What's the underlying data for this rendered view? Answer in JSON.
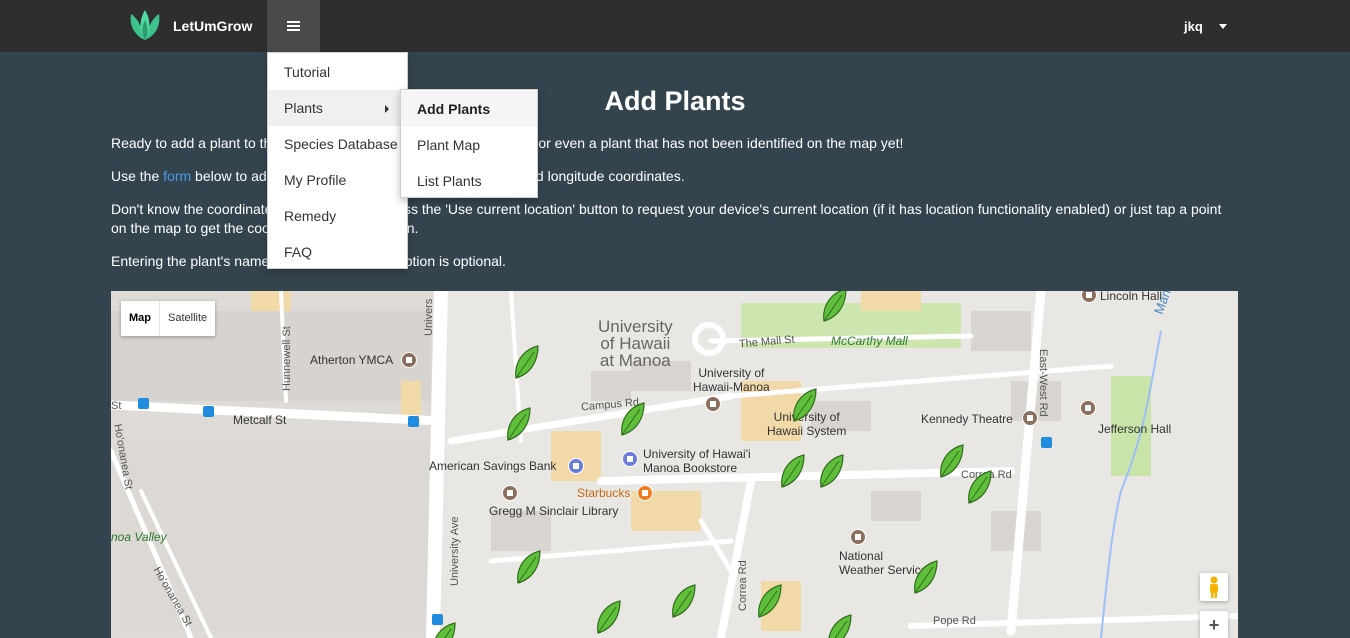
{
  "nav": {
    "brand": "LetUmGrow",
    "user": "jkq",
    "brand_color": "#3cc28b"
  },
  "menu": {
    "items": [
      {
        "label": "Tutorial"
      },
      {
        "label": "Plants"
      },
      {
        "label": "Species Database"
      },
      {
        "label": "My Profile"
      },
      {
        "label": "Remedy"
      },
      {
        "label": "FAQ"
      }
    ],
    "submenu": [
      {
        "label": "Add Plants"
      },
      {
        "label": "Plant Map"
      },
      {
        "label": "List Plants"
      }
    ]
  },
  "page": {
    "title": "Add Plants",
    "p1": "Ready to add a plant to the database? You can add an existing plant or even a plant that has not been identified on the map yet!",
    "p2_pre": "Use the ",
    "p2_link": "form",
    "p2_post": " below to add a plant to the database with its latitude and longitude coordinates.",
    "p3": "Don't know the coordinates? You can either press the 'Use current location' button to request your device's current location (if it has location functionality enabled) or just tap a point on the map to get the coordinates at that location.",
    "p4": "Entering the plant's name is optional and description is optional."
  },
  "map": {
    "type_map": "Map",
    "type_satellite": "Satellite",
    "zoom_in": "+",
    "labels": {
      "uh": "University\nof Hawaii\nat Manoa",
      "mall": "The Mall St",
      "mccarthy": "McCarthy Mall",
      "lincoln": "Lincoln Hall",
      "manoa_stream": "Manoa Str",
      "atherton": "Atherton YMCA",
      "hunnewell": "Hunnewell St",
      "metcalf": "Metcalf St",
      "campus": "Campus Rd",
      "uhm": "University of\nHawaii-Manoa",
      "uhs": "University of\nHawaii System",
      "kennedy": "Kennedy Theatre",
      "jefferson": "Jefferson Hall",
      "eastwest": "East-West Rd",
      "asb": "American Savings Bank",
      "bookstore": "University of Hawai'i\nManoa Bookstore",
      "starbucks": "Starbucks",
      "gregg": "Gregg M Sinclair Library",
      "correa": "Correa Rd",
      "univ_ave": "University Ave",
      "manoa_valley": "noa Valley",
      "honanea": "Ho'onanea St",
      "nws": "National\nWeather Services",
      "pope": "Pope Rd",
      "university_top": "Univers",
      "st": "St"
    }
  }
}
